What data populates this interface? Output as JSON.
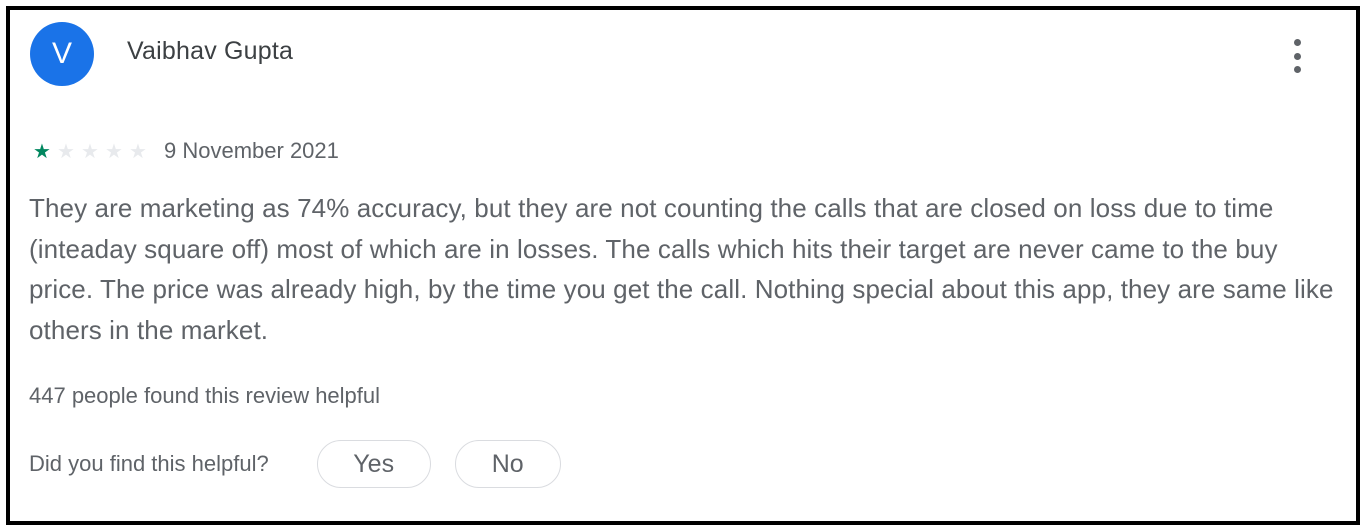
{
  "review": {
    "avatar_initial": "V",
    "reviewer_name": "Vaibhav Gupta",
    "rating": 1,
    "max_rating": 5,
    "date": "9 November 2021",
    "text": "They are marketing as 74% accuracy, but they are not counting the calls that are closed on loss due to time (inteaday square off) most of which are in losses. The calls which hits their target are never came to the buy price. The price was already high, by the time you get the call. Nothing special about this app, they are same like others in the market.",
    "helpful_count_text": "447 people found this review helpful",
    "helpful_question": "Did you find this helpful?",
    "yes_label": "Yes",
    "no_label": "No"
  },
  "icons": {
    "more": "more-vert-icon",
    "star": "star-icon"
  },
  "colors": {
    "avatar": "#1a73e8",
    "star_filled": "#01875f",
    "star_empty": "#e8eaed",
    "text_secondary": "#5f6368",
    "text_primary": "#3c4043"
  }
}
